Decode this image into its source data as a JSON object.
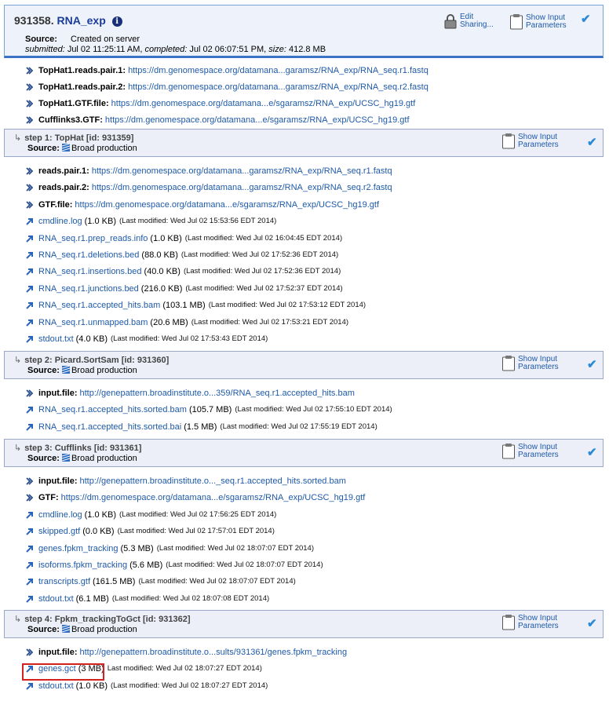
{
  "job": {
    "id": "931358.",
    "name": "RNA_exp",
    "info_icon": "i",
    "source_label": "Source:",
    "source_value": "Created on server",
    "submitted_label": "submitted:",
    "submitted_value": "Jul 02 11:25:11 AM,",
    "completed_label": "completed:",
    "completed_value": "Jul 02 06:07:51 PM,",
    "size_label": "size:",
    "size_value": "412.8 MB",
    "edit_sharing_line1": "Edit",
    "edit_sharing_line2": "Sharing...",
    "show_input_line1": "Show Input",
    "show_input_line2": "Parameters",
    "inputs": [
      {
        "name": "TopHat1.reads.pair.1:",
        "url": "https://dm.genomespace.org/datamana...garamsz/RNA_exp/RNA_seq.r1.fastq"
      },
      {
        "name": "TopHat1.reads.pair.2:",
        "url": "https://dm.genomespace.org/datamana...garamsz/RNA_exp/RNA_seq.r2.fastq"
      },
      {
        "name": "TopHat1.GTF.file:",
        "url": "https://dm.genomespace.org/datamana...e/sgaramsz/RNA_exp/UCSC_hg19.gtf"
      },
      {
        "name": "Cufflinks3.GTF:",
        "url": "https://dm.genomespace.org/datamana...e/sgaramsz/RNA_exp/UCSC_hg19.gtf"
      }
    ]
  },
  "common": {
    "source_label": "Source:",
    "broad": "Broad production",
    "show_input_line1": "Show Input",
    "show_input_line2": "Parameters",
    "check": "✔",
    "arrow": "↳"
  },
  "steps": [
    {
      "title": "step 1: TopHat [id: 931359]",
      "inputs": [
        {
          "name": "reads.pair.1:",
          "url": "https://dm.genomespace.org/datamana...garamsz/RNA_exp/RNA_seq.r1.fastq"
        },
        {
          "name": "reads.pair.2:",
          "url": "https://dm.genomespace.org/datamana...garamsz/RNA_exp/RNA_seq.r2.fastq"
        },
        {
          "name": "GTF.file:",
          "url": "https://dm.genomespace.org/datamana...e/sgaramsz/RNA_exp/UCSC_hg19.gtf"
        }
      ],
      "outputs": [
        {
          "file": "cmdline.log",
          "size": "(1.0 KB)",
          "mod": "(Last modified: Wed Jul 02 15:53:56 EDT 2014)"
        },
        {
          "file": "RNA_seq.r1.prep_reads.info",
          "size": "(1.0 KB)",
          "mod": "(Last modified: Wed Jul 02 16:04:45 EDT 2014)"
        },
        {
          "file": "RNA_seq.r1.deletions.bed",
          "size": "(88.0 KB)",
          "mod": "(Last modified: Wed Jul 02 17:52:36 EDT 2014)"
        },
        {
          "file": "RNA_seq.r1.insertions.bed",
          "size": "(40.0 KB)",
          "mod": "(Last modified: Wed Jul 02 17:52:36 EDT 2014)"
        },
        {
          "file": "RNA_seq.r1.junctions.bed",
          "size": "(216.0 KB)",
          "mod": "(Last modified: Wed Jul 02 17:52:37 EDT 2014)"
        },
        {
          "file": "RNA_seq.r1.accepted_hits.bam",
          "size": "(103.1 MB)",
          "mod": "(Last modified: Wed Jul 02 17:53:12 EDT 2014)"
        },
        {
          "file": "RNA_seq.r1.unmapped.bam",
          "size": "(20.6 MB)",
          "mod": "(Last modified: Wed Jul 02 17:53:21 EDT 2014)"
        },
        {
          "file": "stdout.txt",
          "size": "(4.0 KB)",
          "mod": "(Last modified: Wed Jul 02 17:53:43 EDT 2014)"
        }
      ]
    },
    {
      "title": "step 2: Picard.SortSam [id: 931360]",
      "inputs": [
        {
          "name": "input.file:",
          "url": "http://genepattern.broadinstitute.o...359/RNA_seq.r1.accepted_hits.bam"
        }
      ],
      "outputs": [
        {
          "file": "RNA_seq.r1.accepted_hits.sorted.bam",
          "size": "(105.7 MB)",
          "mod": "(Last modified: Wed Jul 02 17:55:10 EDT 2014)"
        },
        {
          "file": "RNA_seq.r1.accepted_hits.sorted.bai",
          "size": "(1.5 MB)",
          "mod": "(Last modified: Wed Jul 02 17:55:19 EDT 2014)"
        }
      ]
    },
    {
      "title": "step 3: Cufflinks [id: 931361]",
      "inputs": [
        {
          "name": "input.file:",
          "url": "http://genepattern.broadinstitute.o..._seq.r1.accepted_hits.sorted.bam"
        },
        {
          "name": "GTF:",
          "url": "https://dm.genomespace.org/datamana...e/sgaramsz/RNA_exp/UCSC_hg19.gtf"
        }
      ],
      "outputs": [
        {
          "file": "cmdline.log",
          "size": "(1.0 KB)",
          "mod": "(Last modified: Wed Jul 02 17:56:25 EDT 2014)"
        },
        {
          "file": "skipped.gtf",
          "size": "(0.0 KB)",
          "mod": "(Last modified: Wed Jul 02 17:57:01 EDT 2014)"
        },
        {
          "file": "genes.fpkm_tracking",
          "size": "(5.3 MB)",
          "mod": "(Last modified: Wed Jul 02 18:07:07 EDT 2014)"
        },
        {
          "file": "isoforms.fpkm_tracking",
          "size": "(5.6 MB)",
          "mod": "(Last modified: Wed Jul 02 18:07:07 EDT 2014)"
        },
        {
          "file": "transcripts.gtf",
          "size": "(161.5 MB)",
          "mod": "(Last modified: Wed Jul 02 18:07:07 EDT 2014)"
        },
        {
          "file": "stdout.txt",
          "size": "(6.1 MB)",
          "mod": "(Last modified: Wed Jul 02 18:07:08 EDT 2014)"
        }
      ]
    },
    {
      "title": "step 4: Fpkm_trackingToGct [id: 931362]",
      "inputs": [
        {
          "name": "input.file:",
          "url": "http://genepattern.broadinstitute.o...sults/931361/genes.fpkm_tracking"
        }
      ],
      "outputs": [
        {
          "file": "genes.gct",
          "size": "(3 MB)",
          "mod": "Last modified: Wed Jul 02 18:07:27 EDT 2014)"
        },
        {
          "file": "stdout.txt",
          "size": "(1.0 KB)",
          "mod": "(Last modified: Wed Jul 02 18:07:27 EDT 2014)"
        }
      ]
    }
  ]
}
